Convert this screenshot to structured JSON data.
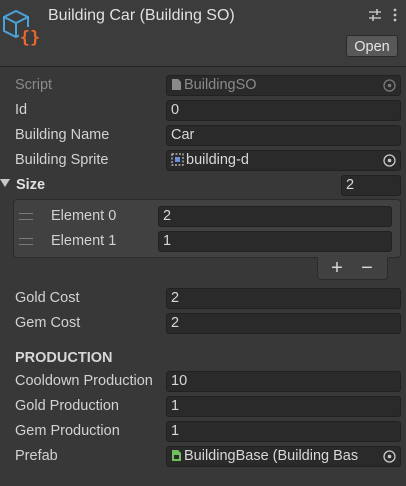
{
  "header": {
    "title": "Building Car (Building SO)",
    "open_label": "Open"
  },
  "fields": {
    "script": {
      "label": "Script",
      "value": "BuildingSO"
    },
    "id": {
      "label": "Id",
      "value": "0"
    },
    "building_name": {
      "label": "Building Name",
      "value": "Car"
    },
    "building_sprite": {
      "label": "Building Sprite",
      "value": "building-d"
    }
  },
  "size_list": {
    "label": "Size",
    "count": "2",
    "elements": [
      {
        "label": "Element 0",
        "value": "2"
      },
      {
        "label": "Element 1",
        "value": "1"
      }
    ],
    "add_label": "+",
    "remove_label": "−"
  },
  "costs": {
    "gold_cost": {
      "label": "Gold Cost",
      "value": "2"
    },
    "gem_cost": {
      "label": "Gem Cost",
      "value": "2"
    }
  },
  "production": {
    "heading": "PRODUCTION",
    "cooldown": {
      "label": "Cooldown Production",
      "value": "10"
    },
    "gold": {
      "label": "Gold Production",
      "value": "1"
    },
    "gem": {
      "label": "Gem Production",
      "value": "1"
    },
    "prefab": {
      "label": "Prefab",
      "value": "BuildingBase (Building Bas"
    }
  },
  "icons": {
    "logo": "scriptable-object-icon",
    "settings": "sliders-icon",
    "menu": "kebab-menu-icon",
    "object_picker": "object-picker-icon"
  },
  "colors": {
    "background": "#383838",
    "logo_cube": "#4aa3d8",
    "logo_braces": "#e8672f"
  }
}
